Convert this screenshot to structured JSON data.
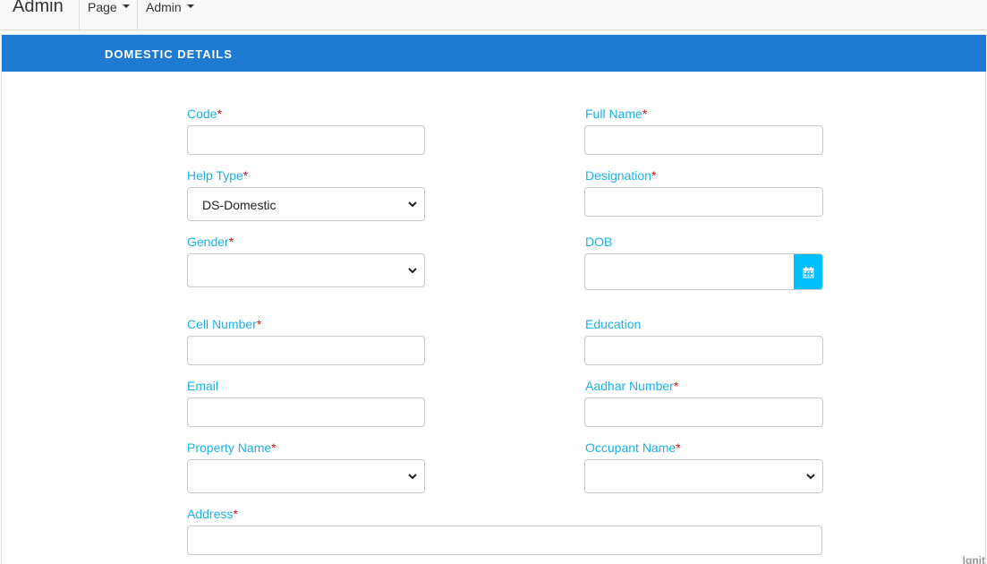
{
  "navbar": {
    "brand": "Admin",
    "menus": [
      {
        "label": "Page"
      },
      {
        "label": "Admin"
      }
    ]
  },
  "panel": {
    "title": "DOMESTIC DETAILS"
  },
  "form": {
    "required_mark": "*",
    "code": {
      "label": "Code",
      "value": ""
    },
    "full_name": {
      "label": "Full Name",
      "value": ""
    },
    "help_type": {
      "label": "Help Type",
      "selected": "DS-Domestic"
    },
    "designation": {
      "label": "Designation",
      "value": ""
    },
    "gender": {
      "label": "Gender",
      "selected": ""
    },
    "dob": {
      "label": "DOB",
      "value": ""
    },
    "cell_number": {
      "label": "Cell Number",
      "value": ""
    },
    "education": {
      "label": "Education",
      "value": ""
    },
    "email": {
      "label": "Email",
      "value": ""
    },
    "aadhar_number": {
      "label": "Aadhar Number",
      "value": ""
    },
    "property_name": {
      "label": "Property Name",
      "selected": ""
    },
    "occupant_name": {
      "label": "Occupant Name",
      "selected": ""
    },
    "address": {
      "label": "Address",
      "value": ""
    }
  },
  "footer": {
    "watermark": "Ignit"
  },
  "colors": {
    "header": "#1e7bd2",
    "label": "#1ab2e8",
    "required": "#e01010",
    "date_button": "#00bfff"
  },
  "icons": {
    "select_arrow": "chevron-down-icon",
    "date_picker": "calendar-icon",
    "dropdown_caret": "caret-down-icon"
  }
}
